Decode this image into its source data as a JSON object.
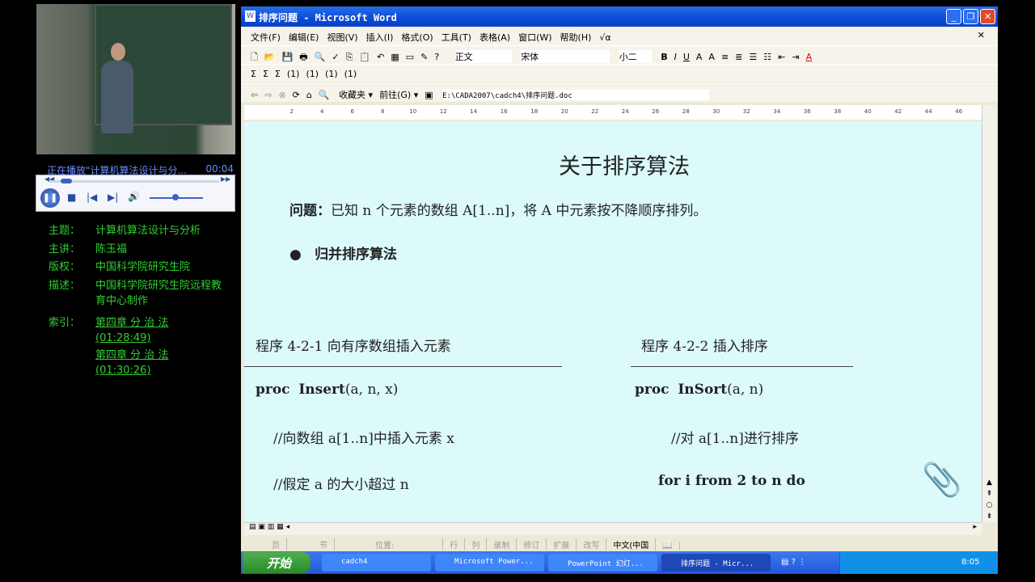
{
  "player": {
    "now_playing": "正在播放\"计算机算法设计与分...",
    "time": "00:04",
    "icons": [
      "rewind-icon",
      "fast-forward-icon",
      "pause-icon",
      "stop-icon",
      "previous-icon",
      "next-icon",
      "volume-icon"
    ],
    "volume_level": 0.6,
    "seek_progress": 0.05
  },
  "info": [
    {
      "key": "主题：",
      "value": "计算机算法设计与分析"
    },
    {
      "key": "主讲：",
      "value": "陈玉福"
    },
    {
      "key": "版权：",
      "value": "中国科学院研究生院"
    },
    {
      "key": "描述：",
      "value": "中国科学院研究生院远程教育中心制作"
    },
    {
      "key": "索引：",
      "links": [
        {
          "label": "第四章 分 治 法",
          "time": "(01:28:49)"
        },
        {
          "label": "第四章 分 治 法",
          "time": "(01:30:26)"
        }
      ]
    }
  ],
  "word": {
    "title": "排序问题 - Microsoft Word",
    "menu": [
      "文件(F)",
      "编辑(E)",
      "视图(V)",
      "插入(I)",
      "格式(O)",
      "工具(T)",
      "表格(A)",
      "窗口(W)",
      "帮助(H)",
      "√α"
    ],
    "style": "正文",
    "font": "宋体",
    "size": "小二",
    "toolbar3": {
      "favorites": "收藏夹 ▾",
      "go": "前往(G) ▾",
      "address": "E:\\CADA2007\\cadch4\\排序问题.doc"
    },
    "toolbar2": [
      "Σ",
      "Σ",
      "Σ",
      "(1)",
      "(1)",
      "(1)",
      "(1)"
    ],
    "ruler": [
      "2",
      "4",
      "6",
      "8",
      "10",
      "12",
      "14",
      "16",
      "18",
      "20",
      "22",
      "24",
      "26",
      "28",
      "30",
      "32",
      "34",
      "36",
      "38",
      "40",
      "42",
      "44",
      "46"
    ],
    "status": [
      "页",
      "节",
      "位置:",
      "行",
      "列",
      "录制",
      "修订",
      "扩展",
      "改写",
      "中文(中国"
    ]
  },
  "doc": {
    "heading": "关于排序算法",
    "problem_label": "问题：",
    "problem": "已知 n 个元素的数组 A[1..n]，将 A 中元素按不降顺序排列。",
    "bullet": "归并排序算法",
    "left": {
      "caption": "程序 4-2-1  向有序数组插入元素",
      "proc_kw": "proc",
      "proc_name": "Insert",
      "proc_args": "(a,  n,  x)",
      "c1": "//向数组 a[1..n]中插入元素 x",
      "c2": "//假定 a 的大小超过 n"
    },
    "right": {
      "caption": "程序 4-2-2  插入排序",
      "proc_kw": "proc",
      "proc_name": "InSort",
      "proc_args": "(a,  n)",
      "c1": "//对 a[1..n]进行排序",
      "for_line": "for i from 2 to n do"
    }
  },
  "taskbar": {
    "start": "开始",
    "tasks": [
      "cadch4",
      "Microsoft Power...",
      "PowerPoint 幻灯...",
      "排序问题 - Micr..."
    ],
    "clock": "8:05"
  }
}
